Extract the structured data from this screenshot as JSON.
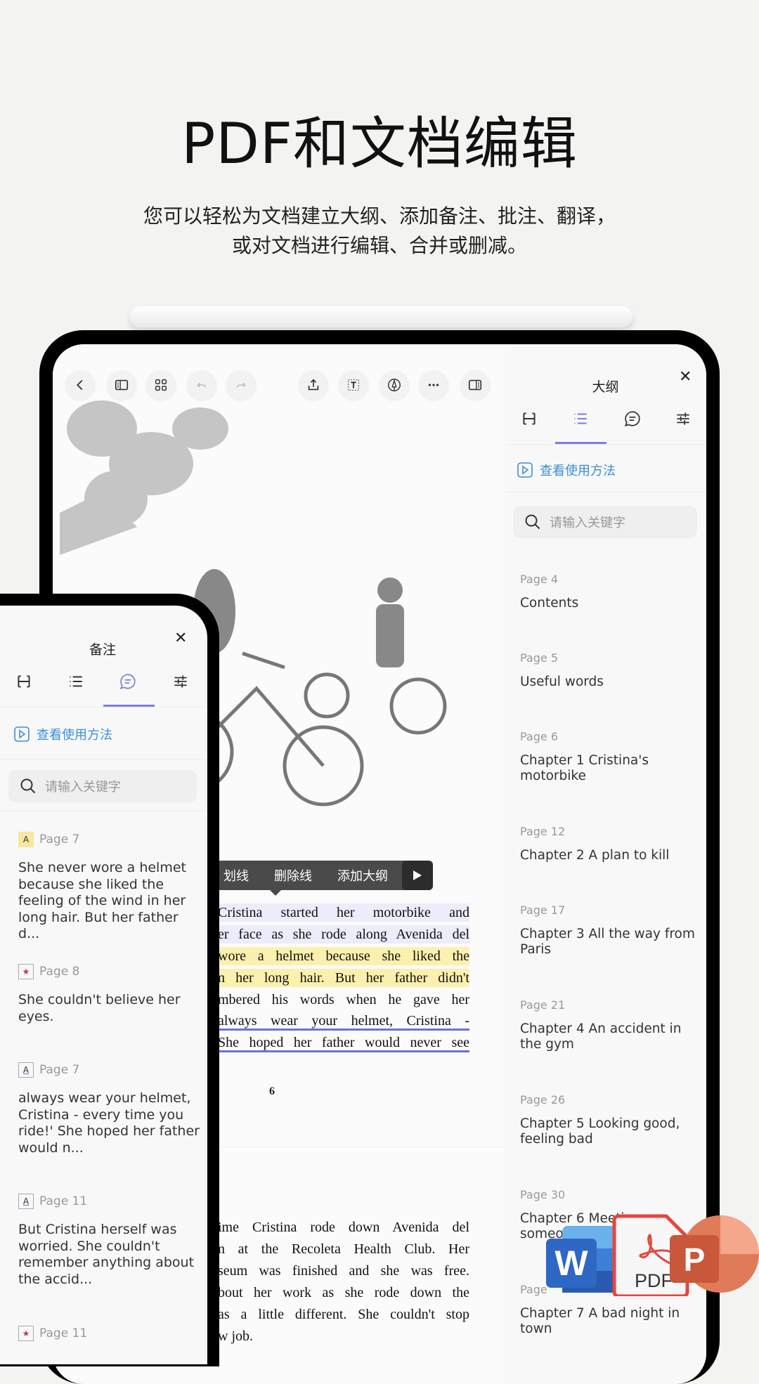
{
  "header": {
    "title": "PDF和文档编辑",
    "subtitle_lines": [
      "您可以轻松为文档建立大纲、添加备注、批注、翻译，",
      "或对文档进行编辑、合并或删减。"
    ]
  },
  "toolbar": {
    "icons": [
      "back-icon",
      "sidebar-left-icon",
      "grid-icon",
      "undo-icon",
      "redo-icon",
      "share-icon",
      "text-box-icon",
      "pen-icon",
      "more-icon",
      "sidebar-right-icon"
    ]
  },
  "popup": {
    "items": [
      "划线",
      "删除线",
      "添加大纲"
    ],
    "more_icon": "play-icon"
  },
  "document": {
    "page1_lines": [
      {
        "text": "Cristina started her motorbike and",
        "style": "hl1"
      },
      {
        "text": "er face as she rode along Avenida del",
        "style": "hl1"
      },
      {
        "text": "wore a helmet because she liked the",
        "style": "hl2"
      },
      {
        "text": "n her long hair. But her father didn't",
        "style": "hl2"
      },
      {
        "text": "mbered his words when he gave her",
        "style": ""
      },
      {
        "text": "always wear your helmet, Cristina -",
        "style": "ul"
      },
      {
        "text": "She hoped her father would never see",
        "style": "ul"
      }
    ],
    "page_number": "6",
    "page2_lines": [
      "ime Cristina rode down Avenida del",
      "n at the Recoleta Health Club. Her",
      "seum was finished and she was free.",
      "bout her work as she rode down the",
      "as a little different. She couldn't stop",
      "w job."
    ]
  },
  "outline_panel": {
    "title": "大纲",
    "help": "查看使用方法",
    "search_placeholder": "请输入关键字",
    "accent": "#7b7fdc",
    "items": [
      {
        "page": "Page 4",
        "title": "Contents"
      },
      {
        "page": "Page 5",
        "title": "Useful words"
      },
      {
        "page": "Page 6",
        "title": "Chapter 1 Cristina's motorbike"
      },
      {
        "page": "Page 12",
        "title": "Chapter 2 A plan to kill"
      },
      {
        "page": "Page 17",
        "title": "Chapter 3 All the way from Paris"
      },
      {
        "page": "Page 21",
        "title": "Chapter 4 An accident in the gym"
      },
      {
        "page": "Page 26",
        "title": "Chapter 5 Looking good, feeling bad"
      },
      {
        "page": "Page 30",
        "title": "Chapter 6 Meeting someone"
      },
      {
        "page": "Page",
        "title": "Chapter 7 A bad night in town"
      }
    ]
  },
  "notes_panel": {
    "title": "备注",
    "help": "查看使用方法",
    "search_placeholder": "请输入关键字",
    "items": [
      {
        "icon": "highlight",
        "page": "Page 7",
        "text": "She never wore a helmet because she liked the feeling of the wind in her long hair. But her father d..."
      },
      {
        "icon": "star",
        "page": "Page 8",
        "text": "She couldn't believe her eyes."
      },
      {
        "icon": "underline",
        "page": "Page 7",
        "text": "always wear your helmet, Cristina - every time you ride!' She hoped her father would n..."
      },
      {
        "icon": "underline",
        "page": "Page 11",
        "text": "But Cristina herself was worried. She couldn't remember anything about the accid..."
      },
      {
        "icon": "star",
        "page": "Page 11",
        "text": ""
      }
    ]
  },
  "badge": {
    "icons": [
      "word-icon",
      "pdf-icon",
      "powerpoint-icon"
    ],
    "word_letter": "W",
    "pdf_label": "PDF",
    "ppt_letter": "P"
  }
}
